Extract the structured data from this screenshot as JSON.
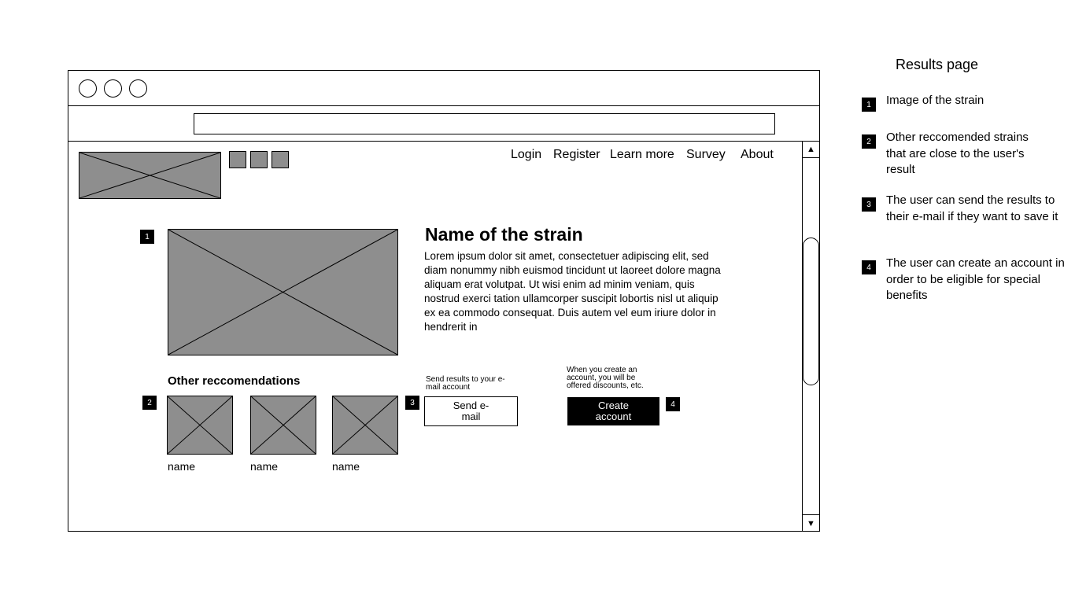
{
  "nav": {
    "items": [
      "Login",
      "Register",
      "Learn more",
      "Survey",
      "About"
    ]
  },
  "main": {
    "markers": [
      "1",
      "2",
      "3",
      "4"
    ],
    "strain_title": "Name of the strain",
    "description": "Lorem ipsum dolor sit amet, consectetuer adipiscing elit, sed diam nonummy nibh euismod tincidunt ut laoreet dolore magna aliquam erat volutpat. Ut wisi enim ad minim veniam, quis nostrud exerci tation ullamcorper suscipit lobortis nisl ut aliquip ex ea commodo consequat. Duis autem vel eum iriure dolor in hendrerit in",
    "recs_heading": "Other reccomendations",
    "recs": [
      {
        "name": "name"
      },
      {
        "name": "name"
      },
      {
        "name": "name"
      }
    ],
    "send_caption": "Send results to your e-mail account",
    "send_button": "Send e-mail",
    "create_caption": "When you create an account, you will be offered discounts, etc.",
    "create_button": "Create account"
  },
  "scrollbar": {
    "up": "▲",
    "down": "▼"
  },
  "legend": {
    "title": "Results page",
    "items": [
      {
        "num": "1",
        "text": "Image of the strain"
      },
      {
        "num": "2",
        "text": "Other reccomended strains that are close to the user's result"
      },
      {
        "num": "3",
        "text": "The user can send the results to their e-mail if they want to save it"
      },
      {
        "num": "4",
        "text": "The user can create an account in order to be eligible for special benefits"
      }
    ]
  }
}
